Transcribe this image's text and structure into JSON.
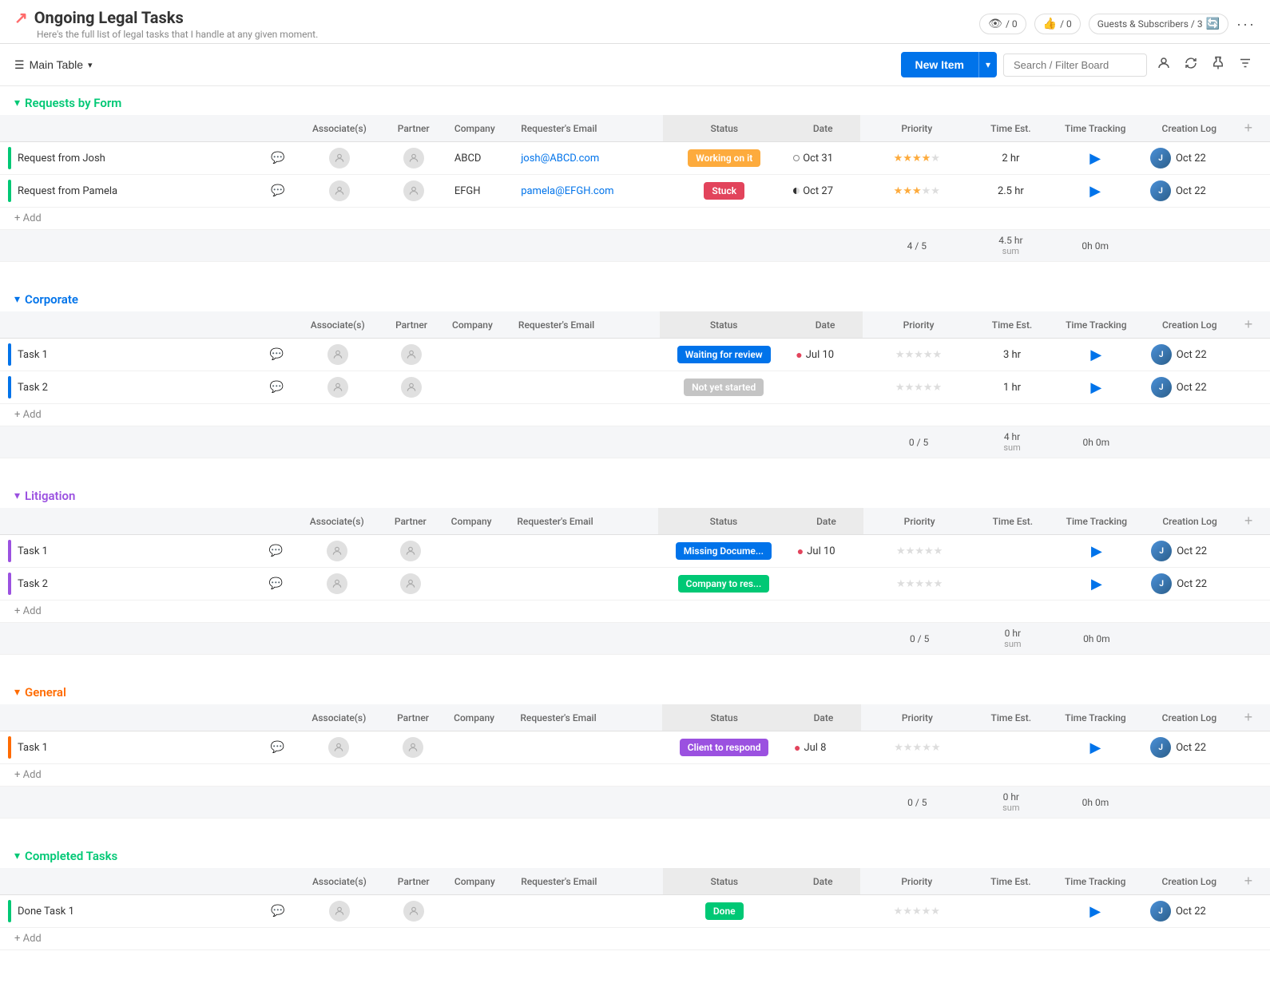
{
  "app": {
    "title": "Ongoing Legal Tasks",
    "subtitle": "Here's the full list of legal tasks that I handle at any given moment.",
    "title_icon": "↗"
  },
  "header": {
    "eye_count": "/ 0",
    "like_count": "/ 0",
    "guests_label": "Guests & Subscribers / 3"
  },
  "toolbar": {
    "table_label": "Main Table",
    "new_item_label": "New Item",
    "search_placeholder": "Search / Filter Board"
  },
  "groups": [
    {
      "id": "requests",
      "title": "Requests by Form",
      "color": "green",
      "icon": "✅",
      "columns": [
        "Associate(s)",
        "Partner",
        "Company",
        "Requester's Email",
        "Status",
        "Date",
        "Priority",
        "Time Est.",
        "Time Tracking",
        "Creation Log"
      ],
      "rows": [
        {
          "name": "Request from Josh",
          "company": "ABCD",
          "email": "josh@ABCD.com",
          "status": "Working on it",
          "status_class": "status-working",
          "date": "Oct 31",
          "date_style": "empty",
          "priority_filled": 4,
          "priority_total": 5,
          "time_est": "2 hr",
          "creation": "Oct 22"
        },
        {
          "name": "Request from Pamela",
          "company": "EFGH",
          "email": "pamela@EFGH.com",
          "status": "Stuck",
          "status_class": "status-stuck",
          "date": "Oct 27",
          "date_style": "half",
          "priority_filled": 3,
          "priority_total": 5,
          "time_est": "2.5 hr",
          "creation": "Oct 22"
        }
      ],
      "summary": {
        "priority": "4 / 5",
        "time_est": "4.5 hr",
        "time_est_label": "sum",
        "time_track": "0h 0m"
      }
    },
    {
      "id": "corporate",
      "title": "Corporate",
      "color": "blue",
      "icon": "🔵",
      "columns": [
        "Associate(s)",
        "Partner",
        "Company",
        "Requester's Email",
        "Status",
        "Date",
        "Priority",
        "Time Est.",
        "Time Tracking",
        "Creation Log"
      ],
      "rows": [
        {
          "name": "Task 1",
          "company": "",
          "email": "",
          "status": "Waiting for review",
          "status_class": "status-waiting",
          "date": "Jul 10",
          "date_style": "alert",
          "priority_filled": 0,
          "priority_total": 5,
          "time_est": "3 hr",
          "creation": "Oct 22"
        },
        {
          "name": "Task 2",
          "company": "",
          "email": "",
          "status": "Not yet started",
          "status_class": "status-notstarted",
          "date": "",
          "date_style": "none",
          "priority_filled": 0,
          "priority_total": 5,
          "time_est": "1 hr",
          "creation": "Oct 22"
        }
      ],
      "summary": {
        "priority": "0 / 5",
        "time_est": "4 hr",
        "time_est_label": "sum",
        "time_track": "0h 0m"
      }
    },
    {
      "id": "litigation",
      "title": "Litigation",
      "color": "purple",
      "icon": "🟣",
      "columns": [
        "Associate(s)",
        "Partner",
        "Company",
        "Requester's Email",
        "Status",
        "Date",
        "Priority",
        "Time Est.",
        "Time Tracking",
        "Creation Log"
      ],
      "rows": [
        {
          "name": "Task 1",
          "company": "",
          "email": "",
          "status": "Missing Docume...",
          "status_class": "status-missing",
          "date": "Jul 10",
          "date_style": "alert",
          "priority_filled": 0,
          "priority_total": 5,
          "time_est": "",
          "creation": "Oct 22"
        },
        {
          "name": "Task 2",
          "company": "",
          "email": "",
          "status": "Company to res...",
          "status_class": "status-company",
          "date": "",
          "date_style": "none",
          "priority_filled": 0,
          "priority_total": 5,
          "time_est": "",
          "creation": "Oct 22"
        }
      ],
      "summary": {
        "priority": "0 / 5",
        "time_est": "0 hr",
        "time_est_label": "sum",
        "time_track": "0h 0m"
      }
    },
    {
      "id": "general",
      "title": "General",
      "color": "orange",
      "icon": "🟠",
      "columns": [
        "Associate(s)",
        "Partner",
        "Company",
        "Requester's Email",
        "Status",
        "Date",
        "Priority",
        "Time Est.",
        "Time Tracking",
        "Creation Log"
      ],
      "rows": [
        {
          "name": "Task 1",
          "company": "",
          "email": "",
          "status": "Client to respond",
          "status_class": "status-client",
          "date": "Jul 8",
          "date_style": "alert",
          "priority_filled": 0,
          "priority_total": 5,
          "time_est": "",
          "creation": "Oct 22"
        }
      ],
      "summary": {
        "priority": "0 / 5",
        "time_est": "0 hr",
        "time_est_label": "sum",
        "time_track": "0h 0m"
      }
    },
    {
      "id": "completed",
      "title": "Completed Tasks",
      "color": "green",
      "icon": "✅",
      "columns": [
        "Associate(s)",
        "Partner",
        "Company",
        "Requester's Email",
        "Status",
        "Date",
        "Priority",
        "Time Est.",
        "Time Tracking",
        "Creation Log"
      ],
      "rows": [
        {
          "name": "Done Task 1",
          "company": "",
          "email": "",
          "status": "Done",
          "status_class": "status-done",
          "date": "",
          "date_style": "none",
          "priority_filled": 0,
          "priority_total": 5,
          "time_est": "",
          "creation": "Oct 22"
        }
      ],
      "summary": null
    }
  ]
}
